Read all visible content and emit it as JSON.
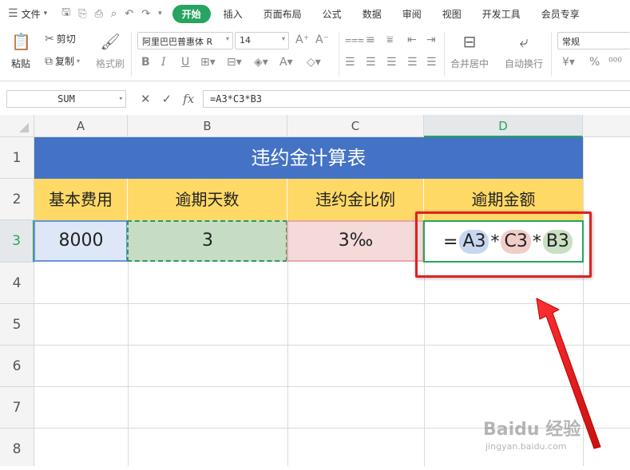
{
  "menubar": {
    "file_label": "文件",
    "tabs": [
      "开始",
      "插入",
      "页面布局",
      "公式",
      "数据",
      "审阅",
      "视图",
      "开发工具",
      "会员专享"
    ]
  },
  "ribbon": {
    "paste_label": "粘贴",
    "cut_label": "剪切",
    "copy_label": "复制",
    "format_painter_label": "格式刷",
    "font_name": "阿里巴巴普惠体 R",
    "font_size": "14",
    "merge_label": "合并居中",
    "wrap_label": "自动换行",
    "number_format": "常规"
  },
  "formula_bar": {
    "name_box": "SUM",
    "formula": "=A3*C3*B3"
  },
  "columns": [
    "A",
    "B",
    "C",
    "D"
  ],
  "rows": [
    "1",
    "2",
    "3",
    "4",
    "5",
    "6",
    "7",
    "8"
  ],
  "sheet": {
    "title": "违约金计算表",
    "headers": [
      "基本费用",
      "逾期天数",
      "违约金比例",
      "逾期金额"
    ],
    "row3": {
      "a": "8000",
      "b": "3",
      "c": "3‰",
      "d_parts": [
        "=",
        "A3",
        "*",
        "C3",
        "*",
        "B3"
      ]
    }
  },
  "watermark": {
    "line1": "Baidu 经验",
    "line2": "jingyan.baidu.com"
  },
  "colors": {
    "accent": "#26a460",
    "title_bg": "#4472c4",
    "header_bg": "#ffd966",
    "highlight": "#e02020"
  }
}
